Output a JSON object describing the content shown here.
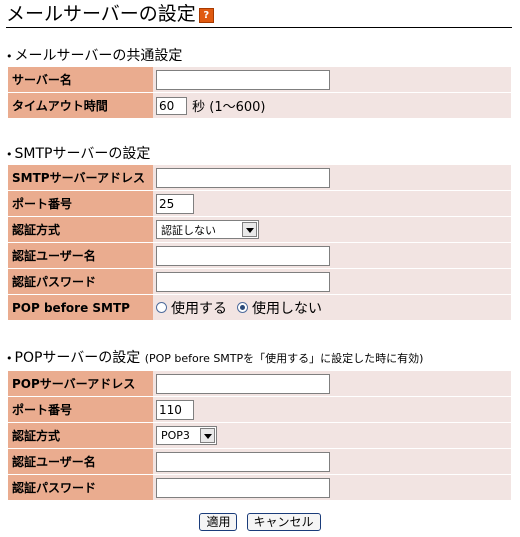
{
  "page": {
    "title": "メールサーバーの設定",
    "help_icon": "?"
  },
  "common": {
    "heading": "メールサーバーの共通設定",
    "server_name": {
      "label": "サーバー名",
      "value": ""
    },
    "timeout": {
      "label": "タイムアウト時間",
      "value": "60",
      "unit": "秒 (1〜600)"
    }
  },
  "smtp": {
    "heading": "SMTPサーバーの設定",
    "address": {
      "label": "SMTPサーバーアドレス",
      "value": ""
    },
    "port": {
      "label": "ポート番号",
      "value": "25"
    },
    "auth_method": {
      "label": "認証方式",
      "selected": "認証しない"
    },
    "auth_user": {
      "label": "認証ユーザー名",
      "value": ""
    },
    "auth_password": {
      "label": "認証パスワード",
      "value": ""
    },
    "pop_before_smtp": {
      "label": "POP before SMTP",
      "option_use": "使用する",
      "option_not_use": "使用しない",
      "selected": "使用しない"
    }
  },
  "pop": {
    "heading": "POPサーバーの設定",
    "heading_note": "(POP before SMTPを「使用する」に設定した時に有効)",
    "address": {
      "label": "POPサーバーアドレス",
      "value": ""
    },
    "port": {
      "label": "ポート番号",
      "value": "110"
    },
    "auth_method": {
      "label": "認証方式",
      "selected": "POP3"
    },
    "auth_user": {
      "label": "認証ユーザー名",
      "value": ""
    },
    "auth_password": {
      "label": "認証パスワード",
      "value": ""
    }
  },
  "buttons": {
    "apply": "適用",
    "cancel": "キャンセル"
  }
}
